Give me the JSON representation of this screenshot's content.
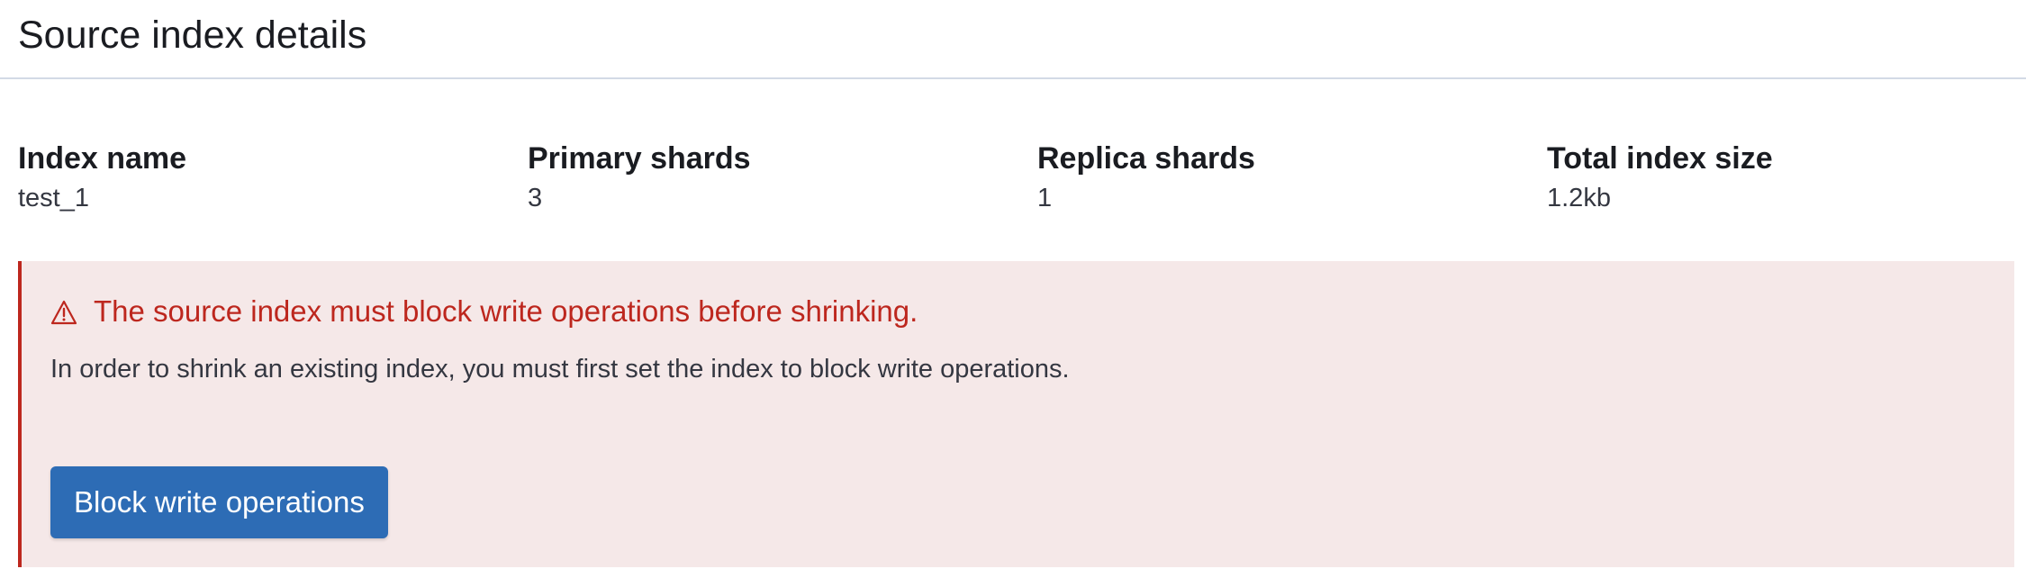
{
  "panel": {
    "title": "Source index details"
  },
  "stats": [
    {
      "label": "Index name",
      "value": "test_1"
    },
    {
      "label": "Primary shards",
      "value": "3"
    },
    {
      "label": "Replica shards",
      "value": "1"
    },
    {
      "label": "Total index size",
      "value": "1.2kb"
    }
  ],
  "callout": {
    "icon": "warning-icon",
    "title": "The source index must block write operations before shrinking.",
    "body": "In order to shrink an existing index, you must first set the index to block write operations.",
    "button_label": "Block write operations"
  },
  "colors": {
    "danger": "#bd271e",
    "callout_background": "#f5e8e8",
    "primary_button": "#2d6cb5"
  }
}
